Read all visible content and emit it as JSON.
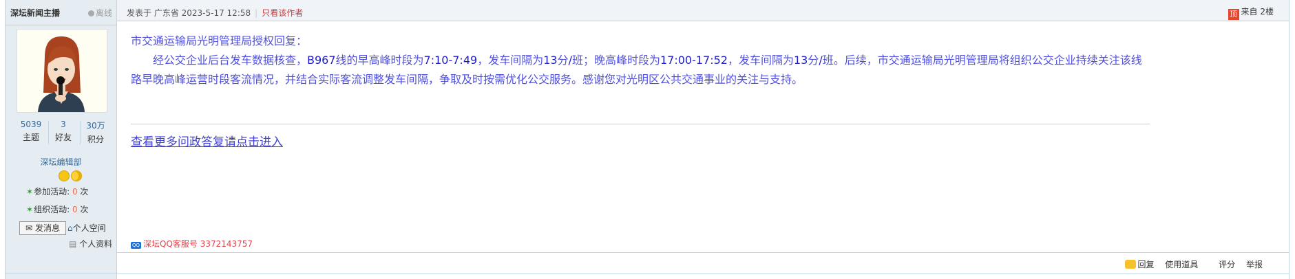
{
  "user": {
    "name": "深坛新闻主播",
    "status": "离线",
    "stats": [
      {
        "value": "5039",
        "label": "主题"
      },
      {
        "value": "3",
        "label": "好友"
      },
      {
        "value": "30万",
        "label": "积分"
      }
    ],
    "group": "深坛编辑部",
    "join_activity_label": "参加活动:",
    "join_activity_count": "0",
    "org_activity_label": "组织活动:",
    "org_activity_count": "0",
    "times_suffix": "次",
    "send_message": "发消息",
    "personal_space": "个人空间",
    "profile": "个人资料"
  },
  "post": {
    "meta_prefix": "发表于 广东省 2023-5-17 12:58",
    "only_author": "只看该作者",
    "floor_badge": "顶",
    "floor": "来自 2楼",
    "reply_title": "市交通运输局光明管理局授权回复：",
    "para_parts": [
      "经公交企业后台发车数据核查，",
      "B967",
      "线的早高峰时段为",
      "7:10-7:49",
      "，发车间隔为",
      "13",
      "分",
      "/",
      "班；晚高峰时段为",
      "17:00-17:52",
      "，发车间隔为",
      "13",
      "分",
      "/",
      "班。后续，市交通运输局光明管理局将组织公交企业持续关注该线路早晚高峰运营时段客流情况，并结合实际客流调整发车间隔，争取及时按需优化公交服务。感谢您对光明区公共交通事业的关注与支持。"
    ],
    "more_link": "查看更多问政答复请点击进入",
    "qq_text": "深坛QQ客服号 3372143757"
  },
  "actions": {
    "reply": "回复",
    "use_tool": "使用道具",
    "rate": "评分",
    "report": "举报"
  },
  "colors": {
    "content": "#5151de",
    "accent_red": "#cc3333",
    "link_blue": "#336699"
  }
}
